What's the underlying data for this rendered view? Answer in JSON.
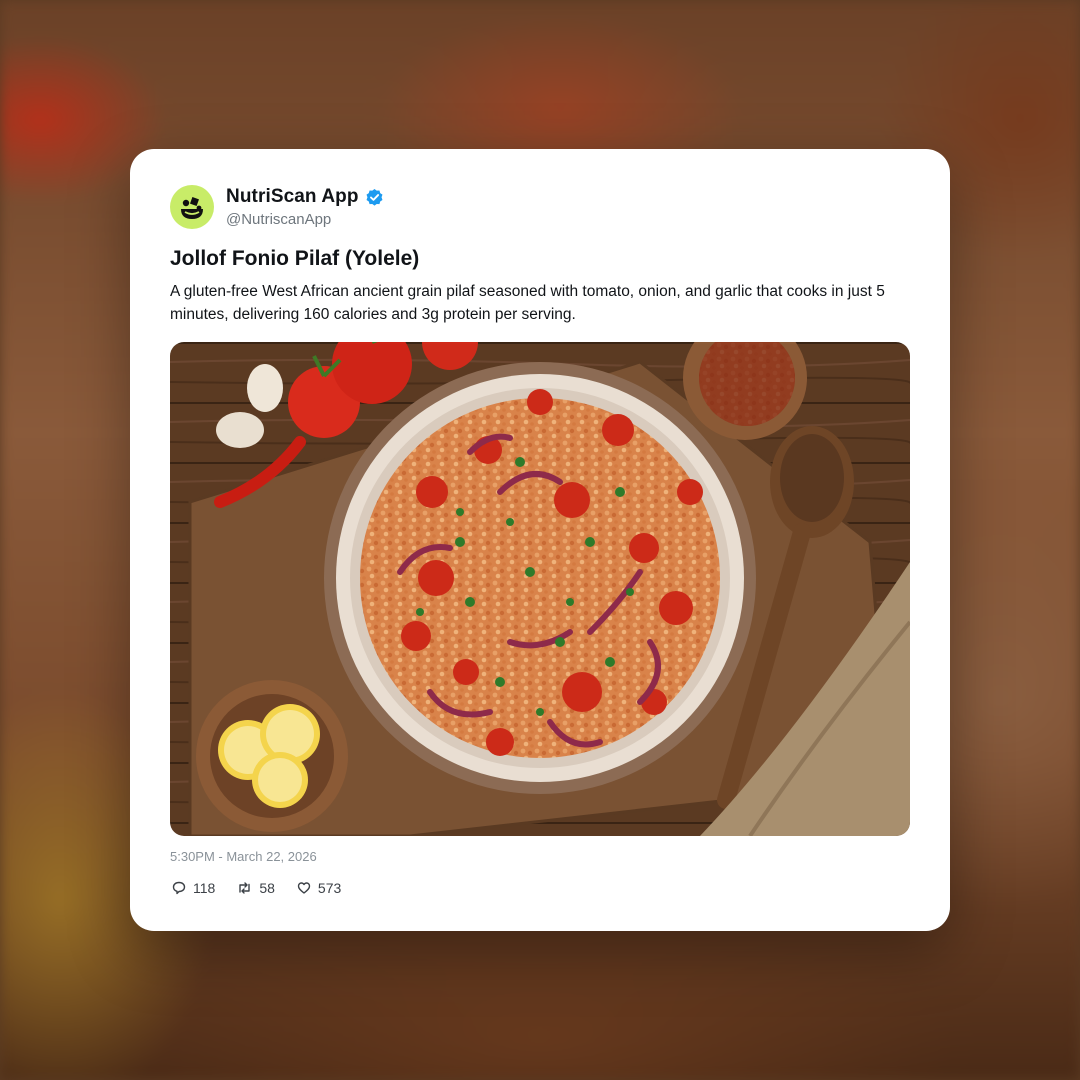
{
  "post": {
    "account_name": "NutriScan App",
    "handle": "@NutriscanApp",
    "verified": true,
    "title": "Jollof Fonio Pilaf (Yolele)",
    "description": "A gluten-free West African ancient grain pilaf seasoned with tomato, onion, and garlic that cooks in just 5 minutes, delivering 160 calories and 3g protein per serving.",
    "timestamp": "5:30PM - March 22, 2026",
    "stats": {
      "replies": "118",
      "reposts": "58",
      "likes": "573"
    }
  },
  "icons": {
    "avatar": "nutriscan-logo-icon",
    "verified": "verified-badge-icon",
    "reply": "comment-icon",
    "repost": "repost-icon",
    "like": "heart-icon"
  },
  "colors": {
    "avatar_bg": "#c8ec68",
    "verified_blue": "#1d9bf0",
    "text": "#111418",
    "muted": "#6e767d"
  }
}
